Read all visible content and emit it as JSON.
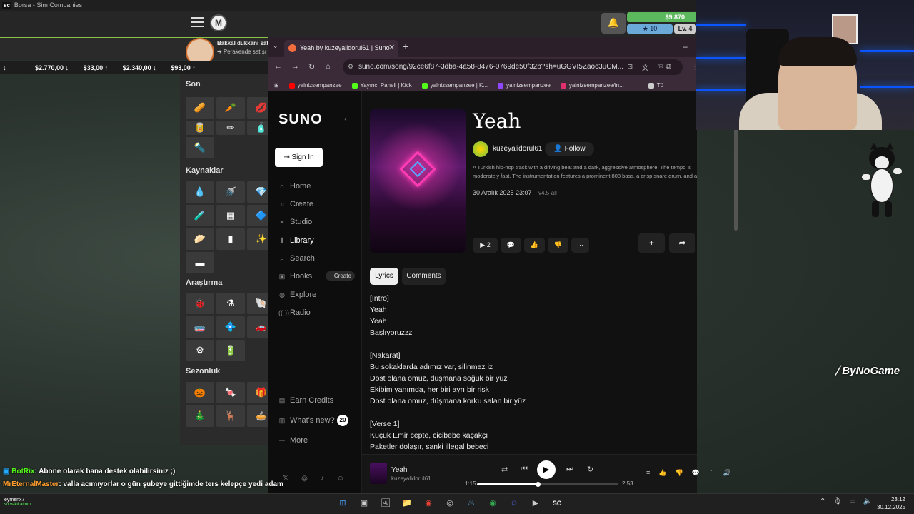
{
  "game": {
    "window_title": "Borsa - Sim Companies",
    "money": "$9.870",
    "stars": "10",
    "level": "Lv. 4",
    "notification_title": "Bakkal dükkanı sat",
    "notification_sub": "➔ Perakende satışı",
    "ticker": [
      "↓",
      "$2.770,00 ↓",
      "$33,00 ↑",
      "$2.340,00 ↓",
      "$93,00 ↑"
    ],
    "sections": [
      "Son",
      "Kaynaklar",
      "Araştırma",
      "Sezonluk"
    ]
  },
  "browser": {
    "tab_title": "Yeah by kuzeyalidorul61 | Suno",
    "url": "suno.com/song/92ce6f87-3dba-4a58-8476-0769de50f32b?sh=uGGVI5Zaoc3uCM...",
    "bookmarks": [
      "yalnizsempanzee",
      "Yayıncı Paneli | Kick",
      "yalnizsempanzee | K...",
      "yalnizsempanzee",
      "yalnizsempanzee/in...",
      "Tü"
    ]
  },
  "suno": {
    "logo": "SUNO",
    "sign_in": "Sign In",
    "nav": [
      "Home",
      "Create",
      "Studio",
      "Library",
      "Search",
      "Hooks",
      "Explore",
      "Radio"
    ],
    "create_chip": "+ Create",
    "bottom_nav": [
      "Earn Credits",
      "What's new?",
      "More"
    ],
    "whats_new_count": "20",
    "song": {
      "title": "Yeah",
      "artist": "kuzeyalidorul61",
      "follow": "Follow",
      "description": "A Turkish hip-hop track with a driving beat and a dark, aggressive atmosphere. The tempo is moderately fast. The instrumentation features a prominent 808 bass, a crisp snare drum, and a hi-...",
      "date": "30 Aralık 2025 23:07",
      "version": "v4.5-all",
      "plays": "2"
    },
    "tabs": [
      "Lyrics",
      "Comments"
    ],
    "lyrics": "[Intro]\nYeah\nYeah\nBaşlıyoruzzz\n\n[Nakarat]\nBu sokaklarda adımız var, silinmez iz\nDost olana omuz, düşmana soğuk bir yüz\nEkibim yanımda, her biri ayrı bir risk\nDost olana omuz, düşmana korku salan bir yüz\n\n[Verse 1]\nKüçük Emir cepte, cicibebe kaçakçı\nPaketler dolaşır, sanki illegal bebeci",
    "player": {
      "title": "Yeah",
      "artist": "kuzeyalidorul61",
      "elapsed": "1:15",
      "total": "2:53",
      "progress": 0.43
    }
  },
  "chat": [
    {
      "user": "BotRix",
      "msg": ": Abone olarak bana destek olabilirsiniz ;)"
    },
    {
      "user": "MrEternalMaster",
      "msg": ": valla acımıyorlar o gün şubeye gittiğimde ters kelepçe yedi adam"
    }
  ],
  "taskbar": {
    "user": "eymenx7",
    "user_status": "su vakti atındı",
    "time": "23:12",
    "date": "30.12.2025"
  },
  "overlay": {
    "brand": "ByNoGame"
  }
}
